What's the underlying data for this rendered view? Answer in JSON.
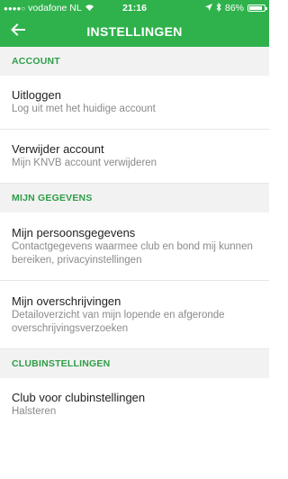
{
  "statusbar": {
    "carrier": "vodafone NL",
    "time": "21:16",
    "battery": "86%",
    "battery_level": 0.86
  },
  "header": {
    "title": "INSTELLINGEN",
    "back_icon": "arrow-left-icon"
  },
  "sections": [
    {
      "title": "ACCOUNT",
      "items": [
        {
          "title": "Uitloggen",
          "subtitle": "Log uit met het huidige account"
        },
        {
          "title": "Verwijder account",
          "subtitle": "Mijn KNVB account verwijderen"
        }
      ]
    },
    {
      "title": "MIJN GEGEVENS",
      "items": [
        {
          "title": "Mijn persoonsgegevens",
          "subtitle": "Contactgegevens waarmee club en bond mij kunnen bereiken, privacyinstellingen"
        },
        {
          "title": "Mijn overschrijvingen",
          "subtitle": "Detailoverzicht van mijn lopende en afgeronde overschrijvingsverzoeken"
        }
      ]
    },
    {
      "title": "CLUBINSTELLINGEN",
      "items": [
        {
          "title": "Club voor clubinstellingen",
          "subtitle": "Halsteren"
        }
      ]
    }
  ],
  "colors": {
    "brand_green": "#2fb24c",
    "section_text": "#2e9e47",
    "section_bg": "#f2f2f2"
  }
}
